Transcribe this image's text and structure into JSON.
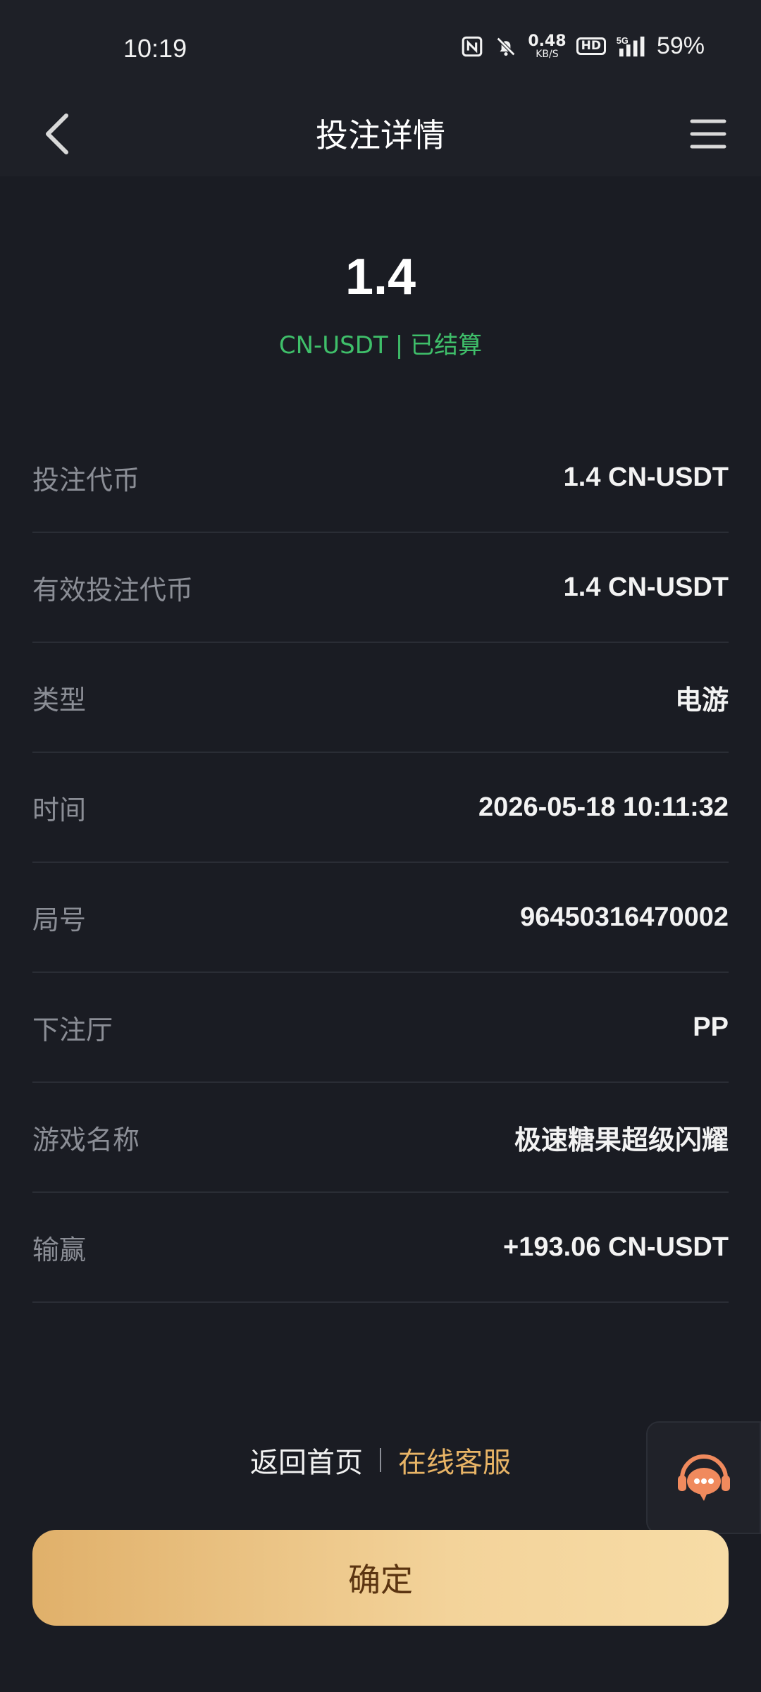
{
  "status_bar": {
    "time": "10:19",
    "speed_value": "0.48",
    "speed_unit": "KB/S",
    "hd_label": "HD",
    "network_label": "5G",
    "battery": "59%"
  },
  "header": {
    "title": "投注详情"
  },
  "summary": {
    "amount": "1.4",
    "currency": "CN-USDT",
    "separator": "|",
    "status": "已结算"
  },
  "rows": [
    {
      "label": "投注代币",
      "value": "1.4 CN-USDT"
    },
    {
      "label": "有效投注代币",
      "value": "1.4 CN-USDT"
    },
    {
      "label": "类型",
      "value": "电游"
    },
    {
      "label": "时间",
      "value": "2026-05-18 10:11:32"
    },
    {
      "label": "局号",
      "value": "96450316470002"
    },
    {
      "label": "下注厅",
      "value": "PP"
    },
    {
      "label": "游戏名称",
      "value": "极速糖果超级闪耀"
    },
    {
      "label": "输赢",
      "value": "+193.06 CN-USDT"
    }
  ],
  "links": {
    "home": "返回首页",
    "service": "在线客服"
  },
  "confirm_label": "确定",
  "colors": {
    "background": "#1a1c23",
    "status_green": "#3fbf6a",
    "accent_gold": "#e8b466",
    "support_orange": "#f08a5d"
  }
}
